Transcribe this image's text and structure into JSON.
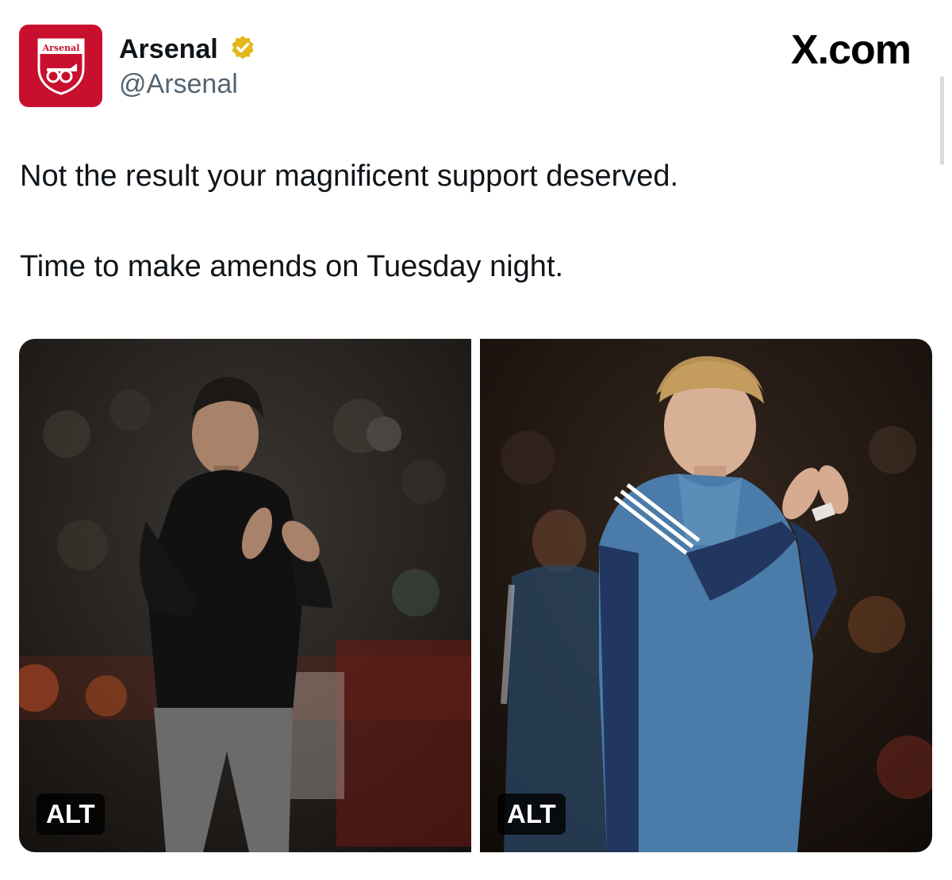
{
  "post": {
    "author": {
      "display_name": "Arsenal",
      "handle": "@Arsenal",
      "verified": true,
      "avatar_logo_text": "Arsenal"
    },
    "site_badge": "X.com",
    "text_lines": [
      "Not the result your magnificent support deserved.",
      "Time to make amends on Tuesday night."
    ],
    "media": [
      {
        "alt_badge": "ALT"
      },
      {
        "alt_badge": "ALT"
      }
    ]
  },
  "colors": {
    "brand_red": "#c8102e",
    "verified_gold": "#e2b719",
    "handle_gray": "#536471",
    "text": "#0f1419"
  },
  "icons": {
    "verified": "verified-badge-icon",
    "avatar": "arsenal-crest-icon"
  }
}
